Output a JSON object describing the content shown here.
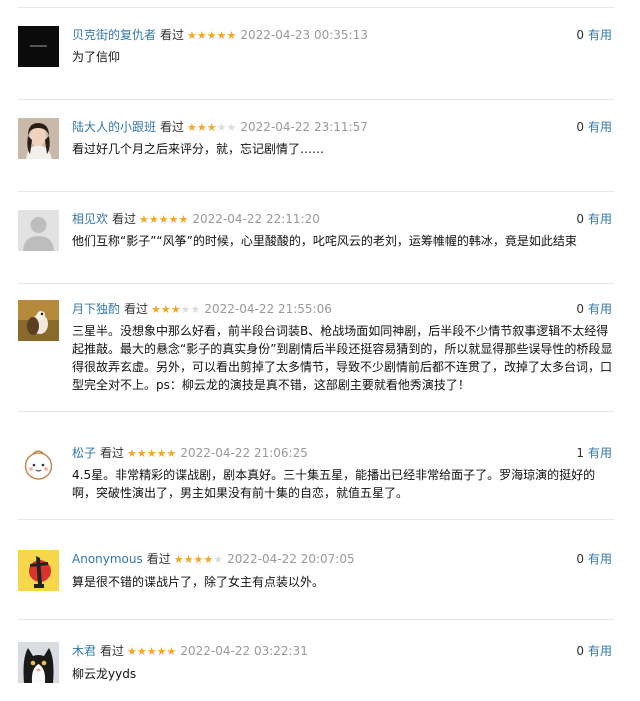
{
  "comments": [
    {
      "user": "贝克街的复仇者",
      "action": "看过",
      "rating": 5,
      "time": "2022-04-23 00:35:13",
      "votes": "0",
      "useful": "有用",
      "content": "为了信仰",
      "avatar": "dark-square-avatar"
    },
    {
      "user": "陆大人的小跟班",
      "action": "看过",
      "rating": 3,
      "time": "2022-04-22 23:11:57",
      "votes": "0",
      "useful": "有用",
      "content": "看过好几个月之后来评分，就，忘记剧情了……",
      "avatar": "woman-portrait-avatar"
    },
    {
      "user": "相见欢",
      "action": "看过",
      "rating": 5,
      "time": "2022-04-22 22:11:20",
      "votes": "0",
      "useful": "有用",
      "content": "他们互称“影子”“风筝”的时候，心里酸酸的，叱咤风云的老刘，运筹帷幄的韩冰，竟是如此结束",
      "avatar": "default-user-avatar"
    },
    {
      "user": "月下独酌",
      "action": "看过",
      "rating": 3,
      "time": "2022-04-22 21:55:06",
      "votes": "0",
      "useful": "有用",
      "content": "三星半。没想象中那么好看，前半段台词装B、枪战场面如同神剧，后半段不少情节叙事逻辑不太经得起推敲。最大的悬念“影子的真实身份”到剧情后半段还挺容易猜到的，所以就显得那些误导性的桥段显得很故弄玄虚。另外，可以看出剪掉了太多情节，导致不少剧情前后都不连贯了，改掉了太多台词，口型完全对不上。ps：柳云龙的演技是真不错，这部剧主要就看他秀演技了！",
      "avatar": "squirrel-avatar"
    },
    {
      "user": "松子",
      "action": "看过",
      "rating": 5,
      "time": "2022-04-22 21:06:25",
      "votes": "1",
      "useful": "有用",
      "content": "4.5星。非常精彩的谍战剧，剧本真好。三十集五星，能播出已经非常给面子了。罗海琼演的挺好的啊，突破性演出了，男主如果没有前十集的自恋，就值五星了。",
      "avatar": "cartoon-bun-avatar"
    },
    {
      "user": "Anonymous",
      "action": "看过",
      "rating": 4,
      "time": "2022-04-22 20:07:05",
      "votes": "0",
      "useful": "有用",
      "content": "算是很不错的谍战片了，除了女主有点装以外。",
      "avatar": "yellow-red-art-avatar"
    },
    {
      "user": "木君",
      "action": "看过",
      "rating": 5,
      "time": "2022-04-22 03:22:31",
      "votes": "0",
      "useful": "有用",
      "content": "柳云龙yyds",
      "avatar": "tuxedo-cat-avatar"
    }
  ]
}
